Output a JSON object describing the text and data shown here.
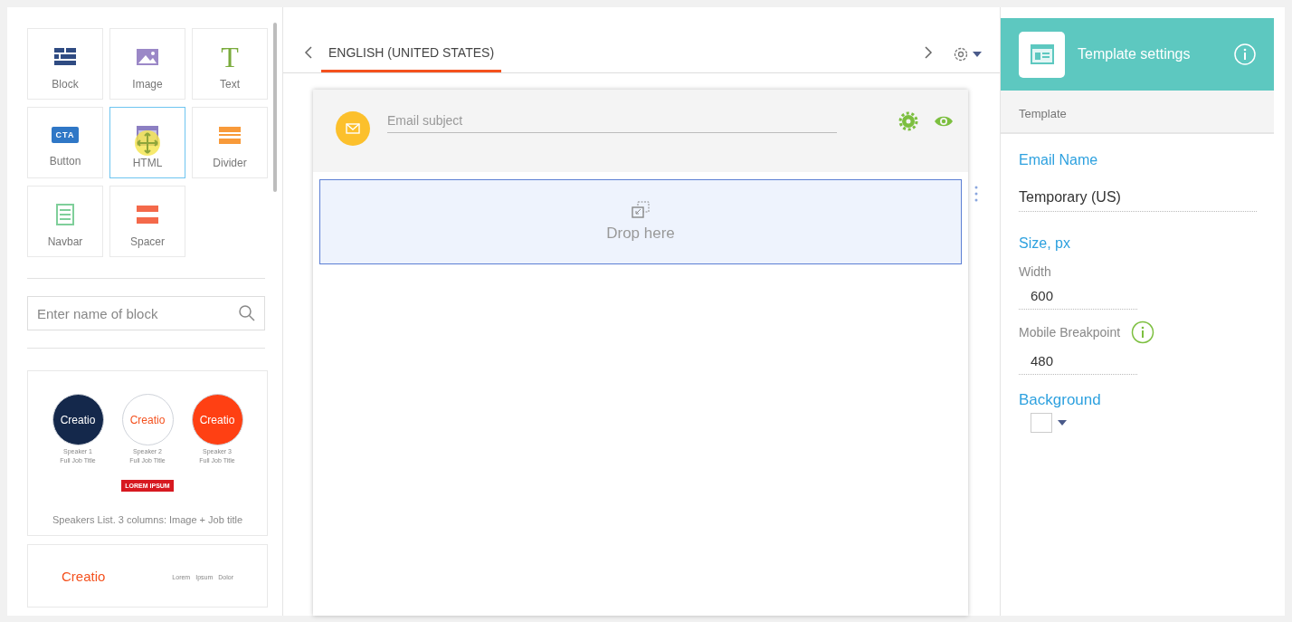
{
  "blocks": [
    {
      "label": "Block",
      "kind": "block",
      "selected": false
    },
    {
      "label": "Image",
      "kind": "image",
      "selected": false
    },
    {
      "label": "Text",
      "kind": "text",
      "glyph": "T",
      "selected": false
    },
    {
      "label": "Button",
      "kind": "button",
      "glyph": "CTA",
      "selected": false
    },
    {
      "label": "HTML",
      "kind": "html",
      "selected": true
    },
    {
      "label": "Divider",
      "kind": "divider",
      "selected": false
    },
    {
      "label": "Navbar",
      "kind": "navbar",
      "selected": false
    },
    {
      "label": "Spacer",
      "kind": "spacer",
      "selected": false
    }
  ],
  "search": {
    "placeholder": "Enter name of block"
  },
  "templates": [
    {
      "kind": "speakers",
      "speakers": [
        {
          "logo": "Creatio",
          "name": "Speaker 1",
          "job_title": "Full Job Title",
          "color": "#14284b"
        },
        {
          "logo": "Creatio",
          "name": "Speaker 2",
          "job_title": "Full Job Title",
          "color": "#ffffff"
        },
        {
          "logo": "Creatio",
          "name": "Speaker 3",
          "job_title": "Full Job Title",
          "color": "#ff4013"
        }
      ],
      "button": "LOREM IPSUM",
      "caption": "Speakers List. 3 columns: Image + Job title"
    },
    {
      "kind": "header",
      "logo": "Creatio",
      "nav": [
        "Lorem",
        "Ipsum",
        "Dolor"
      ]
    }
  ],
  "language_tabs": [
    {
      "label": "ENGLISH (UNITED STATES)",
      "selected": true
    }
  ],
  "email": {
    "subject_placeholder": "Email subject",
    "drop_zone": "Drop here"
  },
  "settings": {
    "title": "Template settings",
    "section": "Template",
    "email_name": {
      "label": "Email Name",
      "value": "Temporary (US)"
    },
    "size": {
      "label": "Size, px",
      "fields": [
        {
          "label": "Width",
          "value": "600"
        },
        {
          "label": "Mobile Breakpoint",
          "value": "480",
          "info": true
        }
      ]
    },
    "background": {
      "label": "Background"
    }
  }
}
